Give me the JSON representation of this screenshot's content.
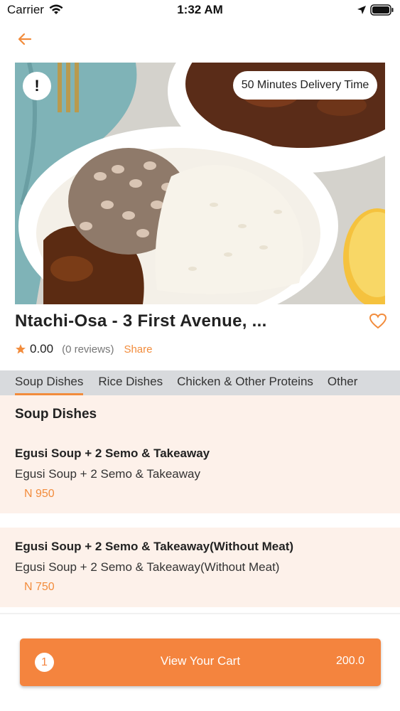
{
  "status_bar": {
    "carrier": "Carrier",
    "time": "1:32 AM"
  },
  "hero": {
    "delivery_badge": "50 Minutes Delivery Time",
    "alert_glyph": "!"
  },
  "restaurant": {
    "name": "Ntachi-Osa - 3 First Avenue, ...",
    "rating": "0.00",
    "reviews": "(0 reviews)",
    "share_label": "Share"
  },
  "tabs": [
    {
      "label": "Soup Dishes",
      "active": true
    },
    {
      "label": "Rice Dishes",
      "active": false
    },
    {
      "label": "Chicken & Other Proteins",
      "active": false
    },
    {
      "label": "Other",
      "active": false
    }
  ],
  "menu": {
    "section_title": "Soup Dishes",
    "items": [
      {
        "title": "Egusi Soup + 2 Semo & Takeaway",
        "description": "Egusi Soup + 2 Semo & Takeaway",
        "price": "N 950"
      },
      {
        "title": "Egusi Soup + 2 Semo & Takeaway(Without Meat)",
        "description": "Egusi Soup + 2 Semo & Takeaway(Without Meat)",
        "price": "N 750"
      }
    ]
  },
  "cart": {
    "count": "1",
    "label": "View Your Cart",
    "total": "200.0"
  },
  "colors": {
    "accent": "#f28c3c",
    "cart_button": "#f4843e",
    "item_background": "#fdf1ea",
    "tab_bar": "#d8dadd"
  },
  "icons": [
    "back-arrow-icon",
    "alert-icon",
    "heart-icon",
    "star-icon",
    "wifi-icon",
    "location-icon",
    "battery-icon"
  ]
}
